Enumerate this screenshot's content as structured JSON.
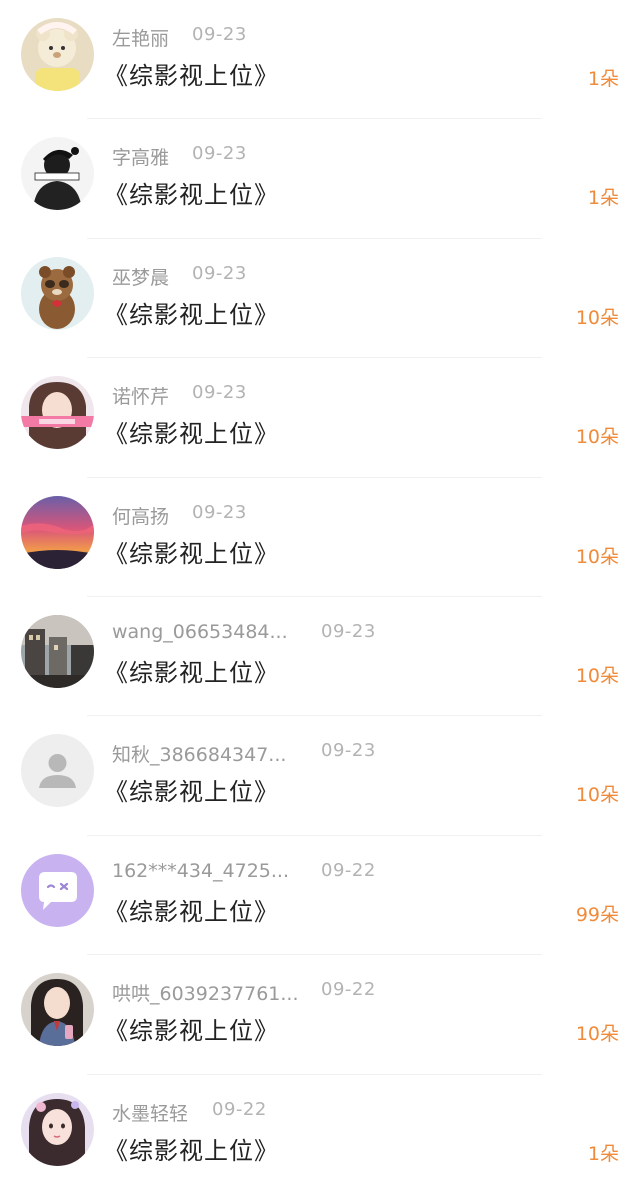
{
  "gift_list": {
    "items": [
      {
        "user": "左艳丽",
        "date": "09-23",
        "book": "《综影视上位》",
        "count": "1朵",
        "avatar_icon": "bear-avatar-icon",
        "date_col": "short"
      },
      {
        "user": "字高雅",
        "date": "09-23",
        "book": "《综影视上位》",
        "count": "1朵",
        "avatar_icon": "masked-figure-avatar-icon",
        "date_col": "short"
      },
      {
        "user": "巫梦晨",
        "date": "09-23",
        "book": "《综影视上位》",
        "count": "10朵",
        "avatar_icon": "raccoon-avatar-icon",
        "date_col": "short"
      },
      {
        "user": "诺怀芹",
        "date": "09-23",
        "book": "《综影视上位》",
        "count": "10朵",
        "avatar_icon": "girl-photo-avatar-icon",
        "date_col": "short"
      },
      {
        "user": "何高扬",
        "date": "09-23",
        "book": "《综影视上位》",
        "count": "10朵",
        "avatar_icon": "sunset-avatar-icon",
        "date_col": "short"
      },
      {
        "user": "wang_06653484...",
        "date": "09-23",
        "book": "《综影视上位》",
        "count": "10朵",
        "avatar_icon": "city-photo-avatar-icon",
        "date_col": "long"
      },
      {
        "user": "知秋_386684347...",
        "date": "09-23",
        "book": "《综影视上位》",
        "count": "10朵",
        "avatar_icon": "default-person-avatar-icon",
        "date_col": "long"
      },
      {
        "user": "162***434_4725...",
        "date": "09-22",
        "book": "《综影视上位》",
        "count": "99朵",
        "avatar_icon": "chat-bubble-avatar-icon",
        "date_col": "long"
      },
      {
        "user": "哄哄_6039237761...",
        "date": "09-22",
        "book": "《综影视上位》",
        "count": "10朵",
        "avatar_icon": "student-girl-avatar-icon",
        "date_col": "long"
      },
      {
        "user": "水墨轻轻",
        "date": "09-22",
        "book": "《综影视上位》",
        "count": "1朵",
        "avatar_icon": "portrait-girl-avatar-icon",
        "date_col": "medium"
      }
    ]
  },
  "colors": {
    "accent_count": "#ef8b3a",
    "name_gray": "#9a9a9a",
    "date_gray": "#b3b3b3",
    "title": "#222222"
  }
}
